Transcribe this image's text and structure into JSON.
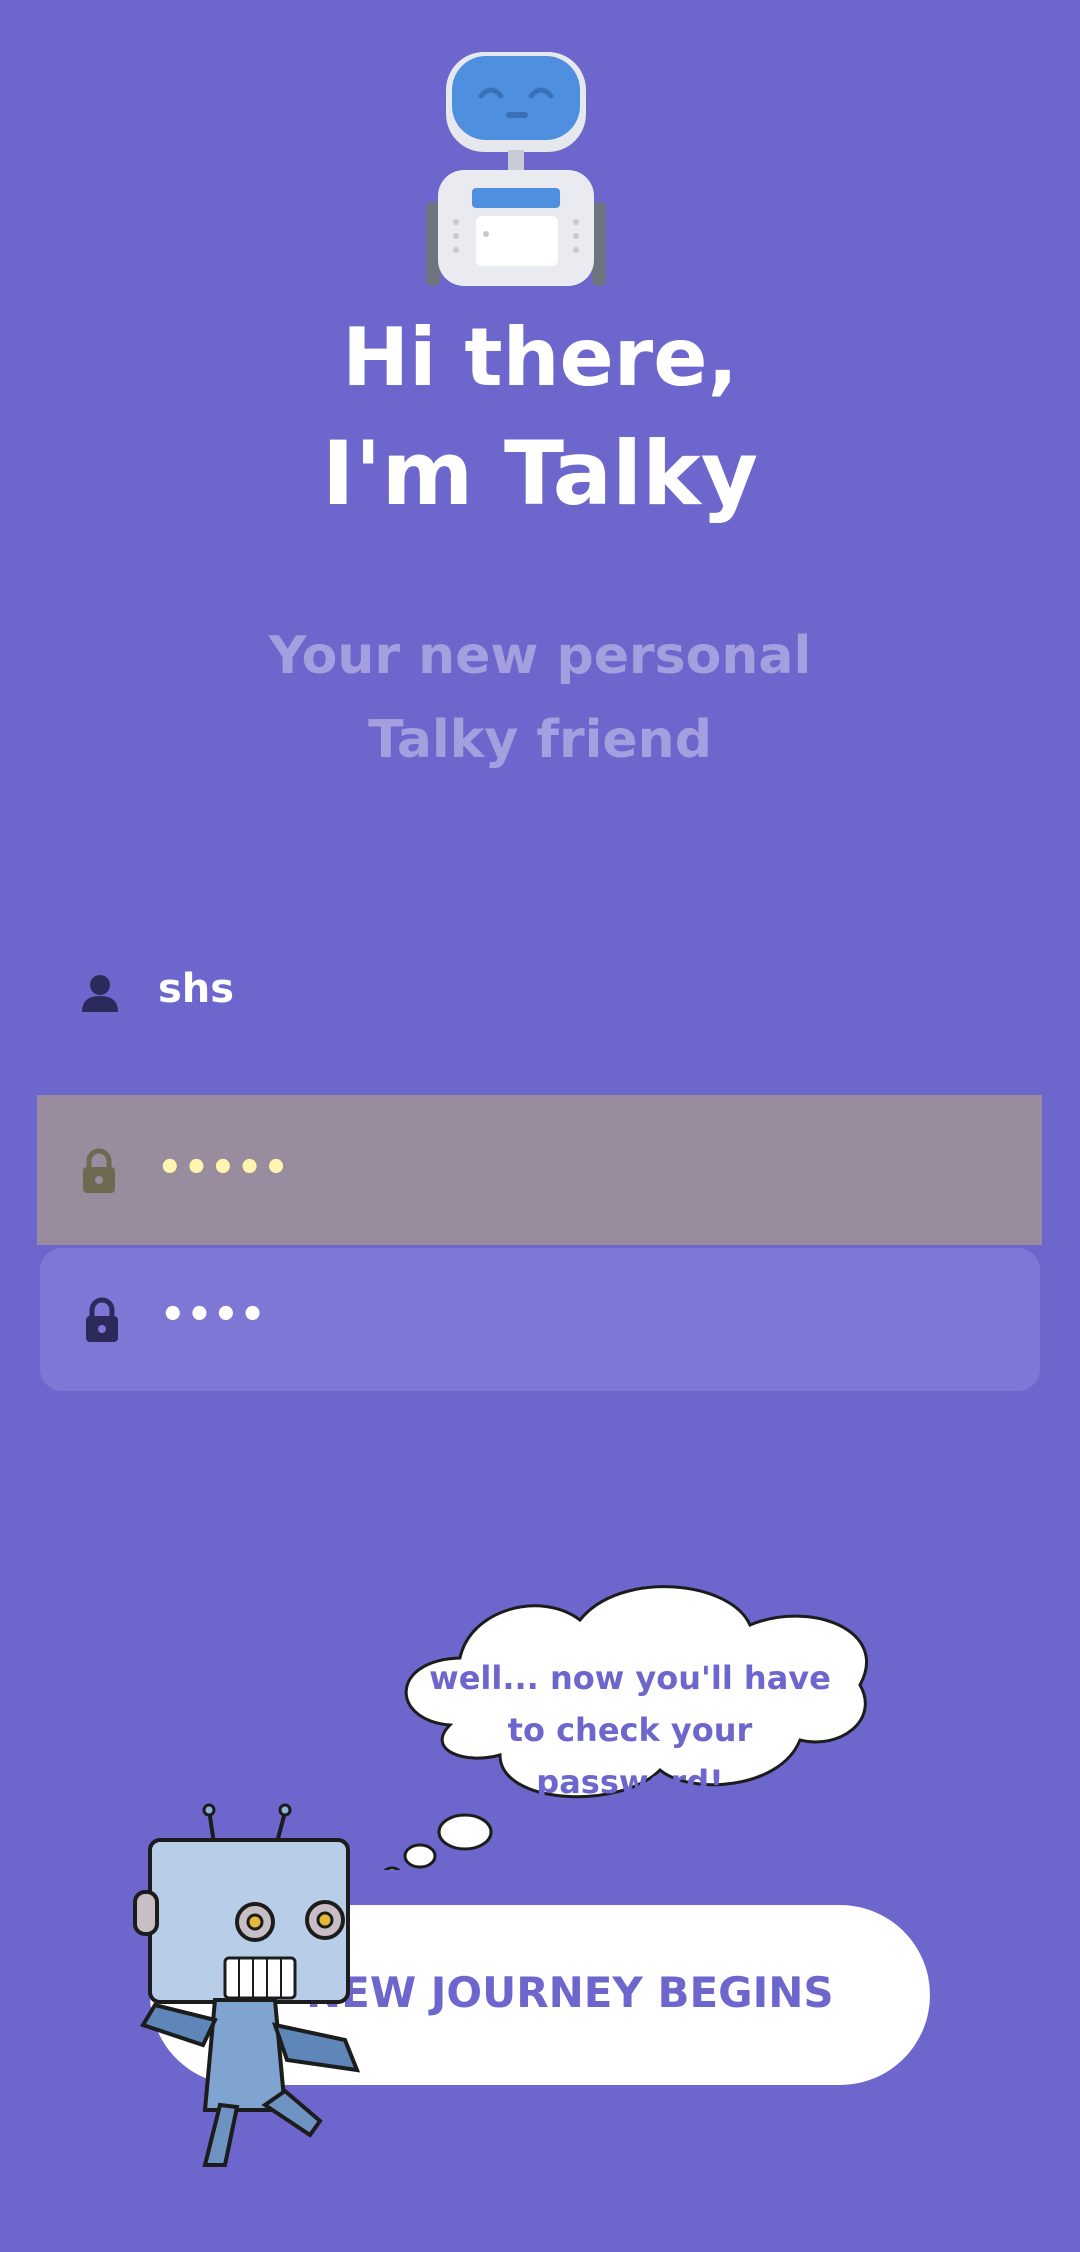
{
  "app": {
    "title_line1": "Hi there,",
    "title_line2": "I'm Talky",
    "subtitle_line1": "Your new personal",
    "subtitle_line2": "Talky friend"
  },
  "form": {
    "username": {
      "value": "shs",
      "icon": "person-icon"
    },
    "password": {
      "value": "•••••",
      "icon": "lock-icon"
    },
    "confirm_password": {
      "value": "••••",
      "icon": "lock-icon"
    }
  },
  "thought_bubble": {
    "line1": "well... now you'll have",
    "line2": "to check your",
    "line3": "password!"
  },
  "cta": {
    "label": "NEW JOURNEY BEGINS"
  },
  "colors": {
    "background": "#6d66cc",
    "field_error": "#998c9e",
    "field_active": "#7f77d6",
    "accent_text": "#6d66cc"
  }
}
